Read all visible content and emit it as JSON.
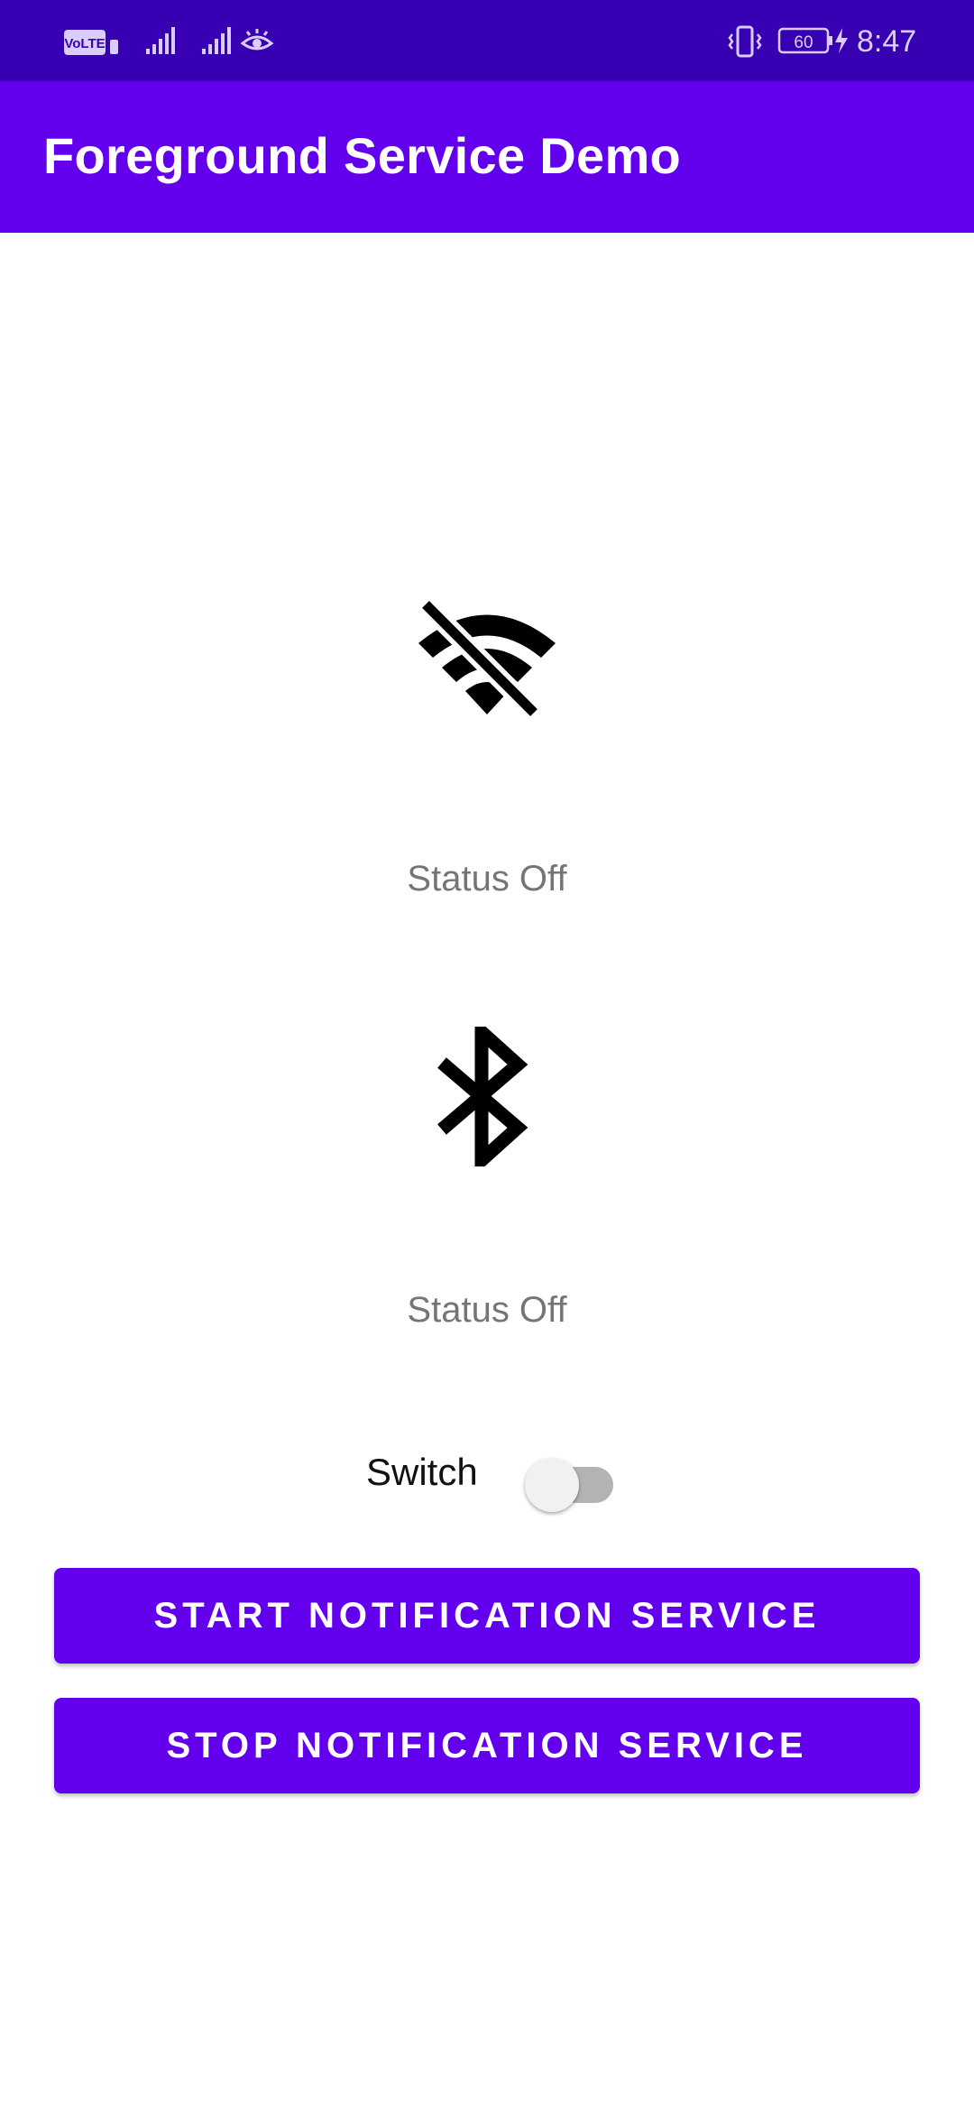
{
  "status_bar": {
    "time": "8:47",
    "battery_level": "60",
    "icons": [
      "volte-icon",
      "signal-icon",
      "signal-icon",
      "eye-icon",
      "vibrate-icon",
      "battery-icon",
      "charging-icon"
    ]
  },
  "app_bar": {
    "title": "Foreground Service Demo"
  },
  "wifi": {
    "icon": "wifi-off-icon",
    "status": "Status Off"
  },
  "bluetooth": {
    "icon": "bluetooth-icon",
    "status": "Status Off"
  },
  "switch": {
    "label": "Switch",
    "checked": false
  },
  "buttons": {
    "start_label": "START NOTIFICATION SERVICE",
    "stop_label": "STOP NOTIFICATION SERVICE"
  },
  "colors": {
    "status_bar": "#3700b3",
    "primary": "#6200ee",
    "status_text": "#757575"
  }
}
